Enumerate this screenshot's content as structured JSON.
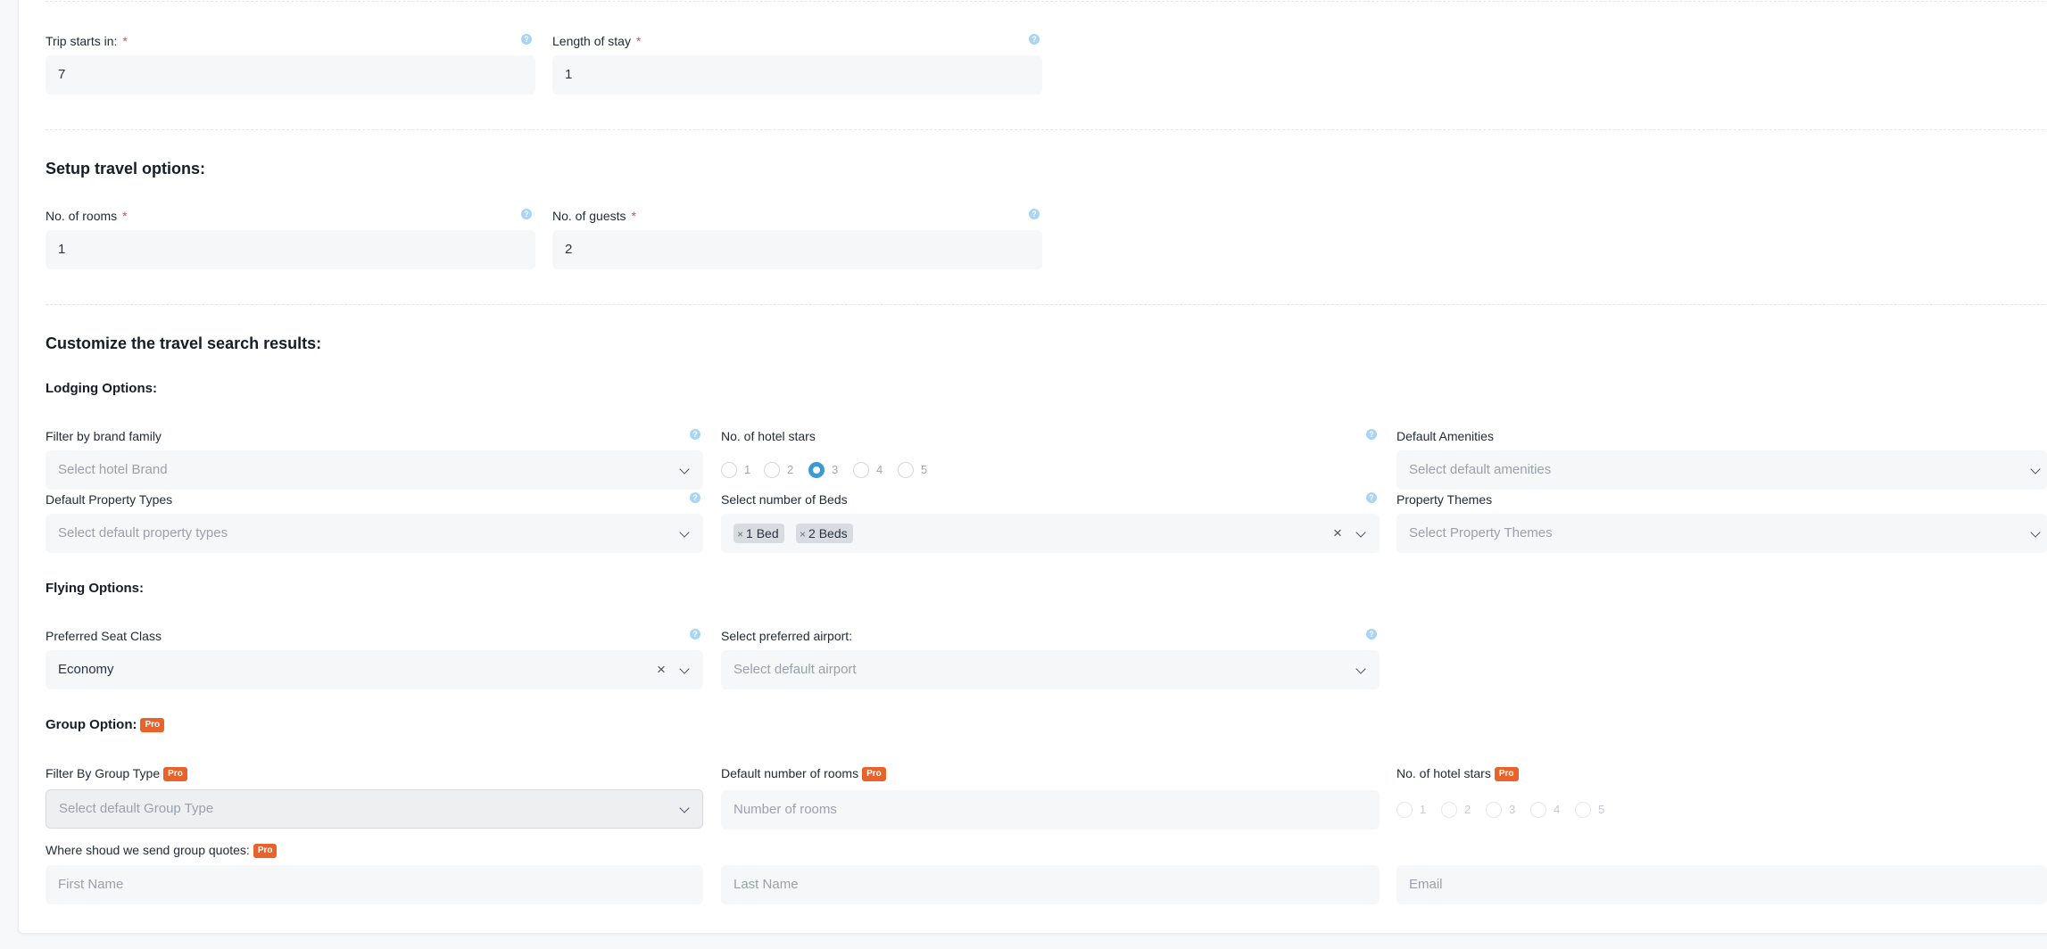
{
  "trip": {
    "starts_label": "Trip starts in:",
    "starts_value": "7",
    "stay_label": "Length of stay",
    "stay_value": "1"
  },
  "setup": {
    "title": "Setup travel options:",
    "rooms_label": "No. of rooms",
    "rooms_value": "1",
    "guests_label": "No. of guests",
    "guests_value": "2"
  },
  "customize": {
    "title": "Customize the travel search results:"
  },
  "lodging": {
    "title": "Lodging Options:",
    "brand_label": "Filter by brand family",
    "brand_placeholder": "Select hotel Brand",
    "stars_label": "No. of hotel stars",
    "stars": [
      "1",
      "2",
      "3",
      "4",
      "5"
    ],
    "stars_selected": "3",
    "amenities_label": "Default Amenities",
    "amenities_placeholder": "Select default amenities",
    "property_types_label": "Default Property Types",
    "property_types_placeholder": "Select default property types",
    "beds_label": "Select number of Beds",
    "beds_selected": [
      "1 Bed",
      "2 Beds"
    ],
    "themes_label": "Property Themes",
    "themes_placeholder": "Select Property Themes"
  },
  "flying": {
    "title": "Flying Options:",
    "seat_label": "Preferred Seat Class",
    "seat_value": "Economy",
    "airport_label": "Select preferred airport:",
    "airport_placeholder": "Select default airport"
  },
  "group": {
    "title": "Group Option:",
    "pro": "Pro",
    "type_label": "Filter By Group Type",
    "type_placeholder": "Select default Group Type",
    "rooms_label": "Default number of rooms",
    "rooms_placeholder": "Number of rooms",
    "stars_label": "No. of hotel stars",
    "stars": [
      "1",
      "2",
      "3",
      "4",
      "5"
    ],
    "quotes_label": "Where shoud we send group quotes:",
    "first_name_placeholder": "First Name",
    "last_name_placeholder": "Last Name",
    "email_placeholder": "Email"
  },
  "icons": {
    "help": "question-mark-icon",
    "chevron": "chevron-down-icon",
    "clear": "close-icon"
  },
  "colors": {
    "accent": "#3b99d6",
    "required": "#e5484d",
    "pro_badge": "#e8622c"
  }
}
